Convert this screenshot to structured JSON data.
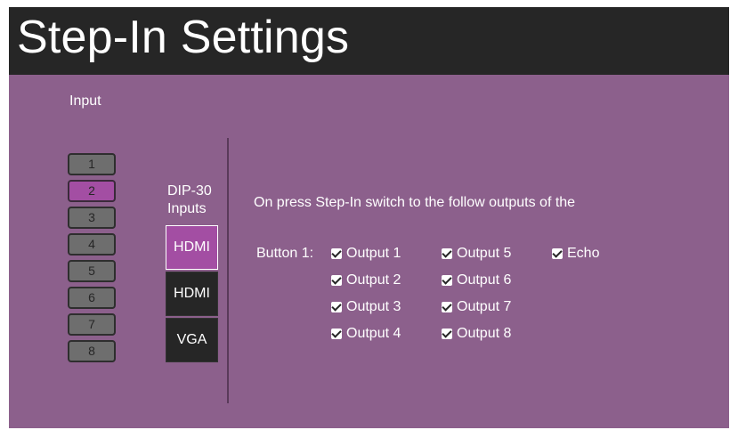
{
  "title": "Step-In Settings",
  "input_label": "Input",
  "inputs": [
    {
      "label": "1",
      "active": false
    },
    {
      "label": "2",
      "active": true
    },
    {
      "label": "3",
      "active": false
    },
    {
      "label": "4",
      "active": false
    },
    {
      "label": "5",
      "active": false
    },
    {
      "label": "6",
      "active": false
    },
    {
      "label": "7",
      "active": false
    },
    {
      "label": "8",
      "active": false
    }
  ],
  "dip_label": "DIP-30 Inputs",
  "dip_inputs": [
    {
      "label": "HDMI",
      "active": true
    },
    {
      "label": "HDMI",
      "active": false
    },
    {
      "label": "VGA",
      "active": false
    }
  ],
  "description": "On press Step-In switch to the follow outputs of the",
  "button_label": "Button 1:",
  "outputs": [
    {
      "label": "Output 1",
      "checked": true
    },
    {
      "label": "Output 2",
      "checked": true
    },
    {
      "label": "Output 3",
      "checked": true
    },
    {
      "label": "Output 4",
      "checked": true
    },
    {
      "label": "Output 5",
      "checked": true
    },
    {
      "label": "Output 6",
      "checked": true
    },
    {
      "label": "Output 7",
      "checked": true
    },
    {
      "label": "Output 8",
      "checked": true
    }
  ],
  "echo": {
    "label": "Echo",
    "checked": true
  },
  "colors": {
    "background": "#8c608c",
    "titlebar": "#262626",
    "accent": "#a34ea3",
    "button_gray": "#6e6e6e"
  }
}
